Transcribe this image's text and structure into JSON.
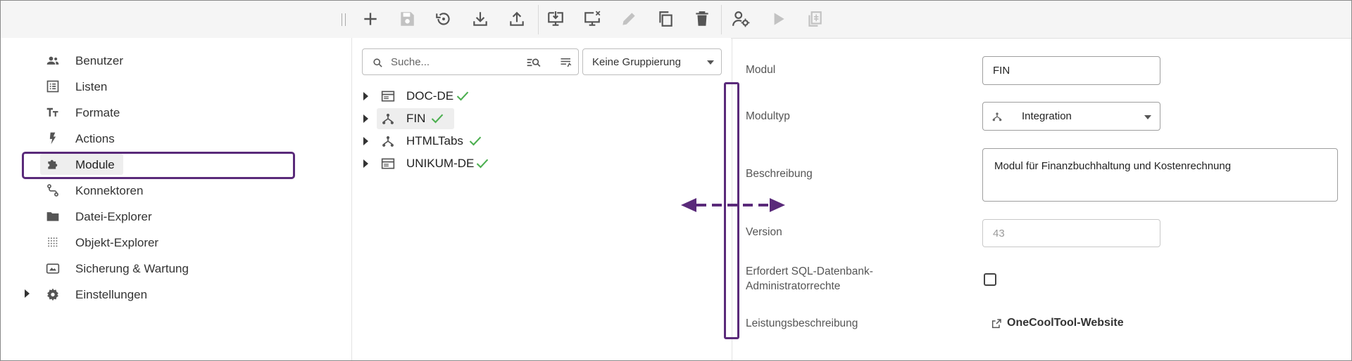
{
  "toolbar": {
    "buttons": [
      {
        "name": "add-button",
        "icon": "plus-icon",
        "enabled": true
      },
      {
        "name": "save-button",
        "icon": "save-icon",
        "enabled": false
      },
      {
        "name": "restore-button",
        "icon": "history-icon",
        "enabled": true
      },
      {
        "name": "import-button",
        "icon": "download-icon",
        "enabled": true
      },
      {
        "name": "export-button",
        "icon": "upload-icon",
        "enabled": true
      },
      {
        "name": "install-button",
        "icon": "monitor-download-icon",
        "enabled": true
      },
      {
        "name": "uninstall-button",
        "icon": "monitor-remove-icon",
        "enabled": true
      },
      {
        "name": "edit-button",
        "icon": "pencil-icon",
        "enabled": false
      },
      {
        "name": "copy-button",
        "icon": "copy-icon",
        "enabled": true
      },
      {
        "name": "delete-button",
        "icon": "trash-icon",
        "enabled": true
      },
      {
        "name": "permissions-button",
        "icon": "user-gear-icon",
        "enabled": true
      },
      {
        "name": "run-button",
        "icon": "play-icon",
        "enabled": false
      },
      {
        "name": "clipboard-button",
        "icon": "clipboard-icon",
        "enabled": false
      }
    ]
  },
  "nav": {
    "items": [
      {
        "label": "Benutzer",
        "icon": "users-icon"
      },
      {
        "label": "Listen",
        "icon": "list-icon"
      },
      {
        "label": "Formate",
        "icon": "text-format-icon"
      },
      {
        "label": "Actions",
        "icon": "lightning-icon"
      },
      {
        "label": "Module",
        "icon": "puzzle-icon",
        "active": true
      },
      {
        "label": "Konnektoren",
        "icon": "connector-icon"
      },
      {
        "label": "Datei-Explorer",
        "icon": "folder-icon"
      },
      {
        "label": "Objekt-Explorer",
        "icon": "grid-dots-icon"
      },
      {
        "label": "Sicherung & Wartung",
        "icon": "backup-icon"
      },
      {
        "label": "Einstellungen",
        "icon": "gear-icon",
        "expandable": true
      }
    ]
  },
  "search": {
    "placeholder": "Suche..."
  },
  "grouping": {
    "value": "Keine Gruppierung"
  },
  "tree": {
    "items": [
      {
        "label": "DOC-DE",
        "icon": "window-icon",
        "valid": true
      },
      {
        "label": "FIN",
        "icon": "integration-icon",
        "valid": true,
        "selected": true
      },
      {
        "label": "HTMLTabs",
        "icon": "integration-icon",
        "valid": true
      },
      {
        "label": "UNIKUM-DE",
        "icon": "window-icon",
        "valid": true
      }
    ]
  },
  "form": {
    "modul_label": "Modul",
    "modul_value": "FIN",
    "modultyp_label": "Modultyp",
    "modultyp_value": "Integration",
    "beschreibung_label": "Beschreibung",
    "beschreibung_value": "Modul für Finanzbuchhaltung und Kostenrechnung",
    "version_label": "Version",
    "version_value": "43",
    "sql_label_line1": "Erfordert SQL-Datenbank-",
    "sql_label_line2": "Administratorrechte",
    "sql_checked": false,
    "leistung_label": "Leistungsbeschreibung",
    "leistung_link": "OneCoolTool-Website"
  },
  "colors": {
    "highlight": "#5a2a7a",
    "check": "#4caf50",
    "icon": "#555555",
    "icon_disabled": "#c2c2c2"
  }
}
